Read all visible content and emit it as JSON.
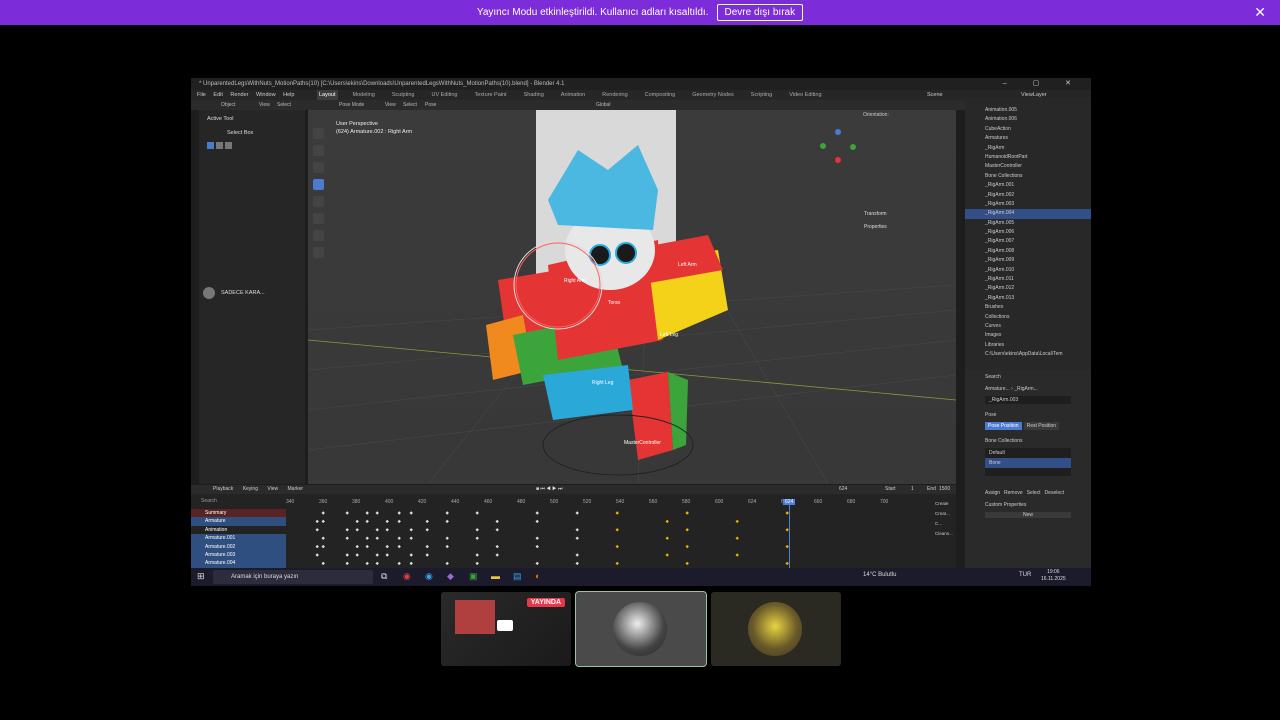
{
  "banner": {
    "message": "Yayıncı Modu etkinleştirildi. Kullanıcı adları kısaltıldı.",
    "button": "Devre dışı bırak"
  },
  "blender": {
    "title": "* UnparentedLegsWithNuts_MotionPaths(10) [C:\\Users\\ekins\\Downloads\\UnparentedLegsWithNuts_MotionPaths(10).blend] - Blender 4.1",
    "menu": [
      "File",
      "Edit",
      "Render",
      "Window",
      "Help"
    ],
    "workspaces": [
      "Layout",
      "Modeling",
      "Sculpting",
      "UV Editing",
      "Texture Paint",
      "Shading",
      "Animation",
      "Rendering",
      "Compositing",
      "Geometry Nodes",
      "Scripting",
      "Video Editing"
    ],
    "scene": "Scene",
    "view_layer": "ViewLayer",
    "header": {
      "mode": "Pose Mode",
      "view": "View",
      "select": "Select",
      "pose": "Pose",
      "transform": "Global",
      "orientation_label": "Orientation:",
      "orientation_value": "Default",
      "drag_label": "Drag:",
      "drag_value": "Select Box",
      "pose_options": "Pose Options"
    },
    "left_panel": {
      "object": "Object",
      "view": "View",
      "select": "Select",
      "active_tool": "Active Tool",
      "select_box": "Select Box"
    },
    "viewport": {
      "line1": "User Perspective",
      "line2": "(624) Armature.002 : Right Arm",
      "labels": [
        "Right Arm",
        "Left Arm",
        "Torso",
        "Left Leg",
        "Right Leg",
        "MasterController"
      ],
      "side_tabs": [
        "Item",
        "Tool",
        "View",
        "Animation",
        "Bsc Animations"
      ],
      "n_panel": [
        "Transform",
        "Properties"
      ]
    },
    "outliner": {
      "search": "Search",
      "rows": [
        "Animation.005",
        "Animation.006",
        "CubeAction",
        "Armatures",
        "_RigArm",
        "HumanoidRootPart",
        "MasterController",
        "Bone Collections",
        "_RigArm.001",
        "_RigArm.002",
        "_RigArm.003",
        "_RigArm.004",
        "_RigArm.005",
        "_RigArm.006",
        "_RigArm.007",
        "_RigArm.008",
        "_RigArm.009",
        "_RigArm.010",
        "_RigArm.011",
        "_RigArm.012",
        "_RigArm.013",
        "Brushes",
        "Collections",
        "Curves",
        "Images",
        "Libraries",
        "C:\\Users\\ekins\\AppData\\Local\\Tem"
      ],
      "selected_index": 11
    },
    "properties": {
      "search": "Search",
      "path1": "Armature...",
      "path2": "_RigArm...",
      "object": "_RigArm.003",
      "pose_section": "Pose",
      "pose_position": "Pose Position",
      "rest_position": "Rest Position",
      "bone_collections": "Bone Collections",
      "bc_default": "Default",
      "bc_bone": "Bone",
      "assign": "Assign",
      "remove": "Remove",
      "select": "Select",
      "deselect": "Deselect",
      "custom_properties": "Custom Properties",
      "new": "New"
    },
    "timeline": {
      "playback": "Playback",
      "keying": "Keying",
      "view": "View",
      "marker": "Marker",
      "current_frame": "624",
      "start_label": "Start",
      "start_value": "1",
      "end_label": "End",
      "end_value": "1500",
      "ticks": [
        "340",
        "360",
        "380",
        "400",
        "420",
        "440",
        "460",
        "480",
        "500",
        "520",
        "540",
        "560",
        "580",
        "600",
        "624",
        "640",
        "660",
        "680",
        "700"
      ],
      "channels": [
        "Summary",
        "Armature",
        "Animation",
        "Armature.001",
        "Armature.002",
        "Armature.003",
        "Armature.004"
      ],
      "search": "Search",
      "side_buttons": [
        "Create",
        "Creat...",
        "C...",
        "Cleans..."
      ]
    },
    "taskbar": {
      "search_placeholder": "Aramak için buraya yazın",
      "weather": "14°C Bulutlu",
      "lang": "TUR",
      "time": "19:06",
      "date": "16.11.2025"
    },
    "chat_name": "SADECE KARA..."
  },
  "tiles": {
    "live_badge": "YAYINDA"
  }
}
